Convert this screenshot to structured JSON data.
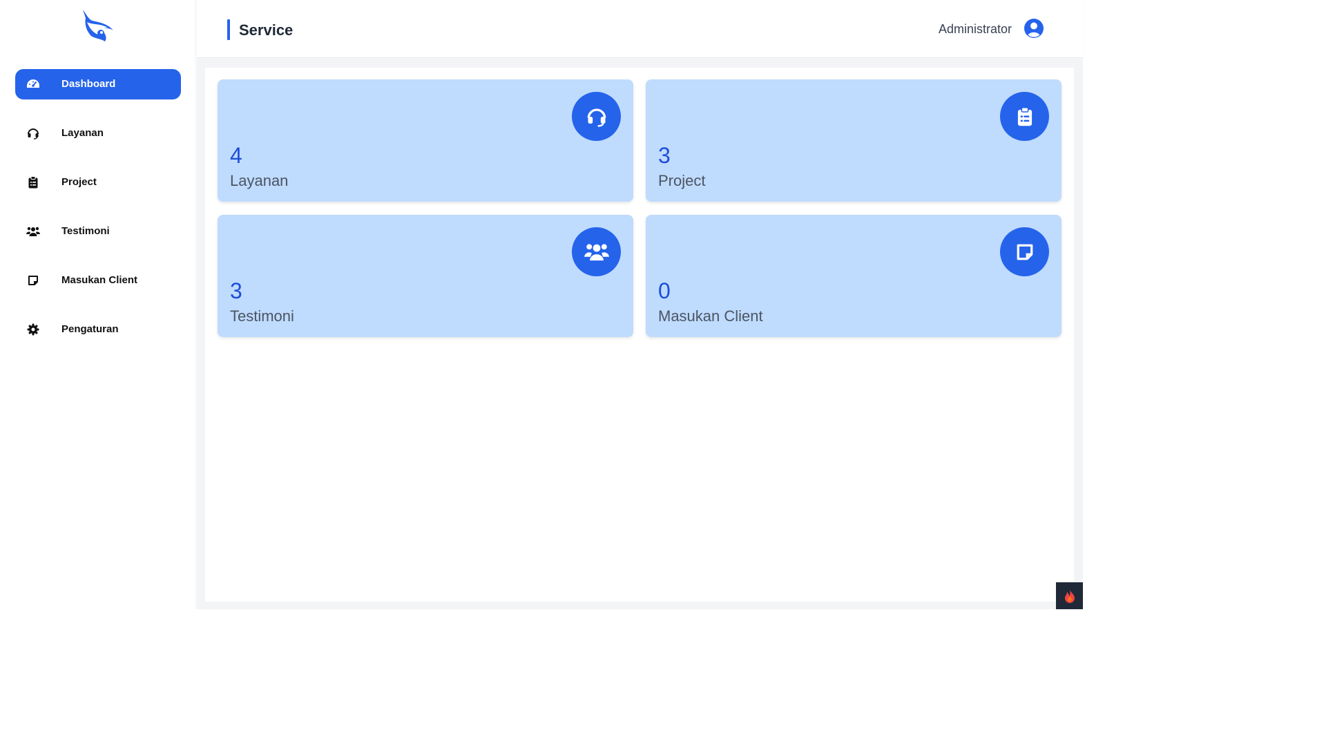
{
  "sidebar": {
    "logo_icon": "eagle-eye-logo",
    "items": [
      {
        "label": "Dashboard",
        "icon": "gauge-icon",
        "active": true
      },
      {
        "label": "Layanan",
        "icon": "headset-icon",
        "active": false
      },
      {
        "label": "Project",
        "icon": "clipboard-list-icon",
        "active": false
      },
      {
        "label": "Testimoni",
        "icon": "users-icon",
        "active": false
      },
      {
        "label": "Masukan Client",
        "icon": "note-icon",
        "active": false
      },
      {
        "label": "Pengaturan",
        "icon": "gear-icon",
        "active": false
      }
    ]
  },
  "header": {
    "title": "Service",
    "user": "Administrator",
    "user_icon": "user-circle-icon"
  },
  "cards": [
    {
      "count": "4",
      "label": "Layanan",
      "icon": "headset-icon"
    },
    {
      "count": "3",
      "label": "Project",
      "icon": "clipboard-list-icon"
    },
    {
      "count": "3",
      "label": "Testimoni",
      "icon": "users-icon"
    },
    {
      "count": "0",
      "label": "Masukan Client",
      "icon": "note-icon"
    }
  ],
  "colors": {
    "accent": "#2563eb",
    "card_bg": "#bfdbfe",
    "count_text": "#1d4ed8"
  }
}
